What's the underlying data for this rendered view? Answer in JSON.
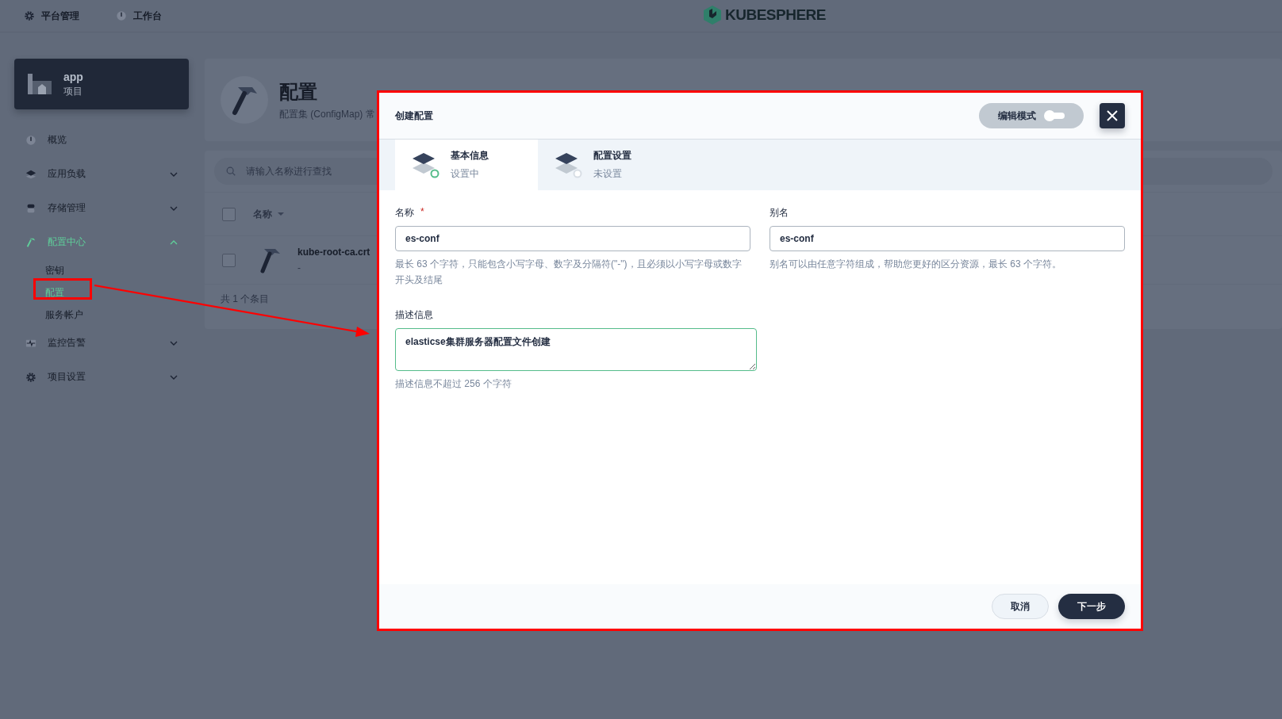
{
  "top_nav": [
    {
      "label": "平台管理"
    },
    {
      "label": "工作台"
    }
  ],
  "logo": {
    "text": "KUBESPHERE"
  },
  "project": {
    "name": "app",
    "type": "项目"
  },
  "sidebar": {
    "items": [
      {
        "kind": "link",
        "label": "概览",
        "selected": false
      },
      {
        "kind": "group",
        "label": "应用负载",
        "expanded": false,
        "selected": false
      },
      {
        "kind": "group",
        "label": "存储管理",
        "expanded": false,
        "selected": false
      },
      {
        "kind": "group",
        "label": "配置中心",
        "expanded": true,
        "selected": true,
        "children": [
          {
            "label": "密钥",
            "selected": false
          },
          {
            "label": "配置",
            "selected": true
          },
          {
            "label": "服务帐户",
            "selected": false
          }
        ]
      },
      {
        "kind": "group",
        "label": "监控告警",
        "expanded": false,
        "selected": false
      },
      {
        "kind": "group",
        "label": "项目设置",
        "expanded": false,
        "selected": false
      }
    ]
  },
  "page_header": {
    "title": "配置",
    "subtitle": "配置集 (ConfigMap) 常"
  },
  "table": {
    "search": {
      "placeholder": "请输入名称进行查找"
    },
    "select_all": {
      "checked": false
    },
    "columns": [
      {
        "label": "名称"
      }
    ],
    "rows": [
      {
        "checked": false,
        "name": "kube-root-ca.crt",
        "description": "-"
      }
    ],
    "footer": "共 1 个条目"
  },
  "modal": {
    "title": "创建配置",
    "edit_mode": {
      "label": "编辑模式",
      "on": false
    },
    "steps": [
      {
        "title": "基本信息",
        "status": "设置中",
        "selected": true
      },
      {
        "title": "配置设置",
        "status": "未设置",
        "selected": false
      }
    ],
    "fields": [
      {
        "kind": "input",
        "label": "名称",
        "required_mark": "*",
        "value": "es-conf",
        "hint": "最长 63 个字符，只能包含小写字母、数字及分隔符(\"-\")，且必须以小写字母或数字开头及结尾",
        "focused": false
      },
      {
        "kind": "input",
        "label": "别名",
        "value": "es-conf",
        "hint": "别名可以由任意字符组成，帮助您更好的区分资源，最长 63 个字符。",
        "focused": false
      },
      {
        "kind": "textarea",
        "label": "描述信息",
        "value": "elasticse集群服务器配置文件创建",
        "hint": "描述信息不超过 256 个字符",
        "focused": true
      }
    ],
    "buttons": [
      {
        "kind": "secondary",
        "label": "取消"
      },
      {
        "kind": "primary",
        "label": "下一步"
      }
    ]
  }
}
